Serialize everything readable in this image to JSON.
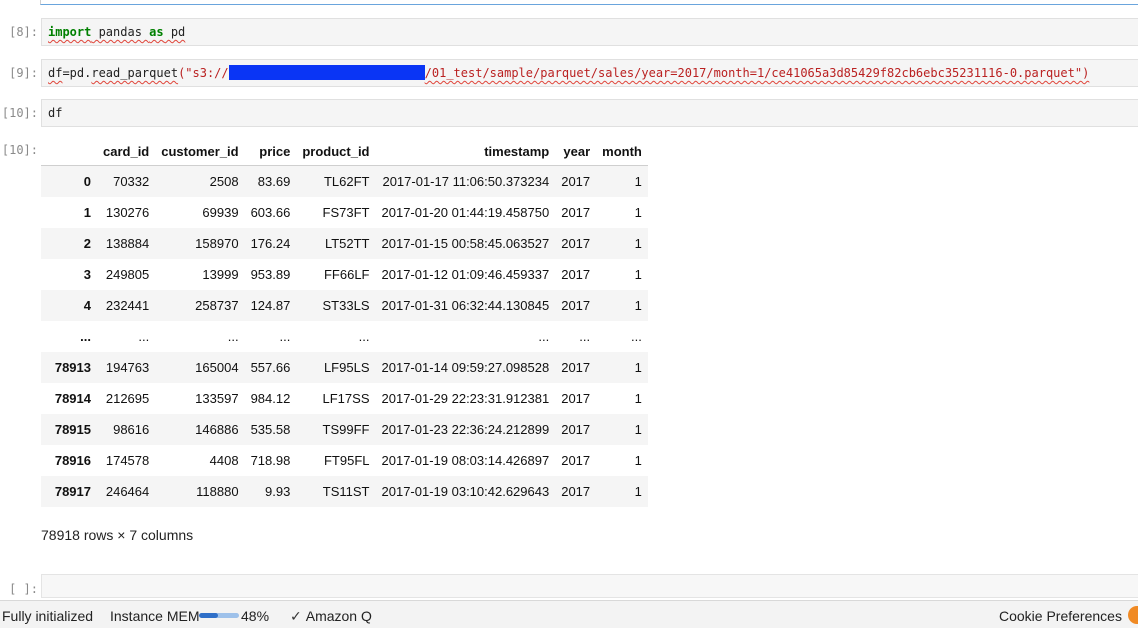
{
  "cells": [
    {
      "prompt": "[8]:",
      "code_parts": [
        {
          "text": "import",
          "cls": "kw squig"
        },
        {
          "text": " pandas ",
          "cls": "nm squig"
        },
        {
          "text": "as",
          "cls": "kw squig"
        },
        {
          "text": " pd",
          "cls": "nm squig"
        }
      ]
    },
    {
      "prompt": "[9]:",
      "code_parts": [
        {
          "text": "df",
          "cls": "nm squig"
        },
        {
          "text": "=pd.",
          "cls": "nm"
        },
        {
          "text": "read_parquet",
          "cls": "nm squig"
        },
        {
          "text": "(\"s3://",
          "cls": "str"
        },
        {
          "text": "",
          "cls": "redact"
        },
        {
          "text": "/01_test/sample/parquet/sales/year=2017/month=1/ce41065a3d85429f82cb6ebc35231116-0.parquet\")",
          "cls": "str squig"
        }
      ]
    },
    {
      "prompt": "[10]:",
      "code_parts": [
        {
          "text": "df",
          "cls": "nm"
        }
      ]
    }
  ],
  "output_prompt": "[10]:",
  "dataframe": {
    "columns": [
      "",
      "card_id",
      "customer_id",
      "price",
      "product_id",
      "timestamp",
      "year",
      "month"
    ],
    "rows": [
      [
        "0",
        "70332",
        "2508",
        "83.69",
        "TL62FT",
        "2017-01-17 11:06:50.373234",
        "2017",
        "1"
      ],
      [
        "1",
        "130276",
        "69939",
        "603.66",
        "FS73FT",
        "2017-01-20 01:44:19.458750",
        "2017",
        "1"
      ],
      [
        "2",
        "138884",
        "158970",
        "176.24",
        "LT52TT",
        "2017-01-15 00:58:45.063527",
        "2017",
        "1"
      ],
      [
        "3",
        "249805",
        "13999",
        "953.89",
        "FF66LF",
        "2017-01-12 01:09:46.459337",
        "2017",
        "1"
      ],
      [
        "4",
        "232441",
        "258737",
        "124.87",
        "ST33LS",
        "2017-01-31 06:32:44.130845",
        "2017",
        "1"
      ],
      [
        "...",
        "...",
        "...",
        "...",
        "...",
        "...",
        "...",
        "..."
      ],
      [
        "78913",
        "194763",
        "165004",
        "557.66",
        "LF95LS",
        "2017-01-14 09:59:27.098528",
        "2017",
        "1"
      ],
      [
        "78914",
        "212695",
        "133597",
        "984.12",
        "LF17SS",
        "2017-01-29 22:23:31.912381",
        "2017",
        "1"
      ],
      [
        "78915",
        "98616",
        "146886",
        "535.58",
        "TS99FF",
        "2017-01-23 22:36:24.212899",
        "2017",
        "1"
      ],
      [
        "78916",
        "174578",
        "4408",
        "718.98",
        "FT95FL",
        "2017-01-19 08:03:14.426897",
        "2017",
        "1"
      ],
      [
        "78917",
        "246464",
        "118880",
        "9.93",
        "TS11ST",
        "2017-01-19 03:10:42.629643",
        "2017",
        "1"
      ]
    ],
    "shape_text": "78918 rows × 7 columns"
  },
  "empty_prompt": "[ ]:",
  "statusbar": {
    "kernel_status": "Fully initialized",
    "mem_label": "Instance MEM",
    "mem_percent_text": "48%",
    "mem_fraction": 0.48,
    "amazon_q": "Amazon Q",
    "cookie": "Cookie Preferences",
    "colors": {
      "mem_fill": "#2f6fc8",
      "mem_track": "#9ec1ea",
      "q_icon": "#f08a24"
    },
    "icons": [
      "check-icon",
      "amazon-q-icon"
    ]
  }
}
